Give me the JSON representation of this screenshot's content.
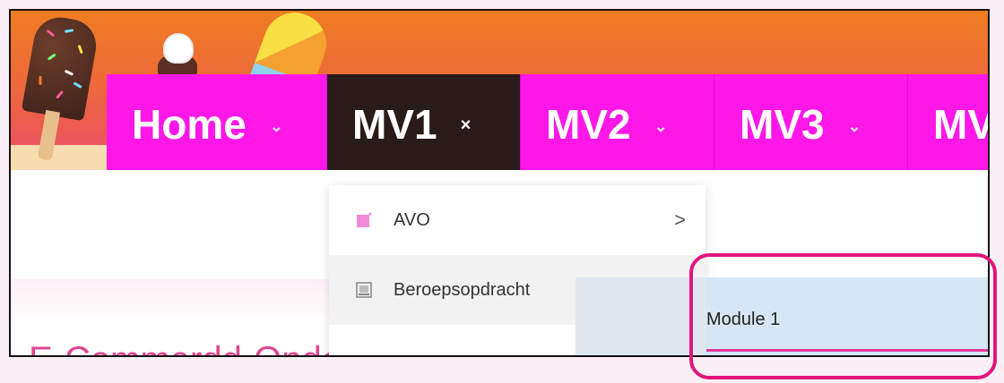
{
  "nav": {
    "items": [
      {
        "label": "Home",
        "chevron": "⌄"
      },
      {
        "label": "MV1",
        "chevron": "×"
      },
      {
        "label": "MV2",
        "chevron": "⌄"
      },
      {
        "label": "MV3",
        "chevron": "⌄"
      },
      {
        "label": "MV"
      }
    ]
  },
  "dropdown": {
    "items": [
      {
        "label": "AVO",
        "arrow": ">",
        "icon": "edit-icon"
      },
      {
        "label": "Beroepsopdracht",
        "arrow": ">",
        "icon": "image-icon"
      }
    ]
  },
  "submenu": {
    "items": [
      {
        "label": "Module 1"
      }
    ]
  },
  "page": {
    "partial_heading": "E-Commerdd-Onderg"
  },
  "colors": {
    "nav_bg": "#ff17e7",
    "nav_active_bg": "#2a1b1b",
    "header_gradient_top": "#ef7c22",
    "highlight": "#e2147d"
  }
}
